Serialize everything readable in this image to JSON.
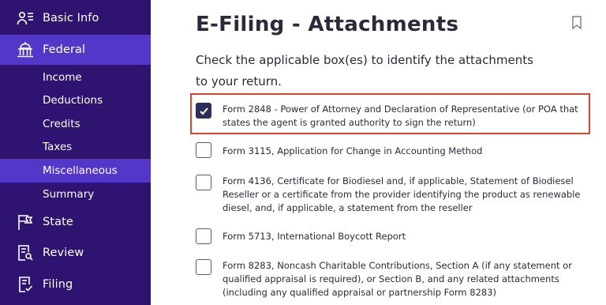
{
  "sidebar": {
    "items": [
      {
        "label": "Basic Info",
        "icon": "person-list-icon"
      },
      {
        "label": "Federal",
        "icon": "capitol-icon",
        "active": true
      },
      {
        "label": "State",
        "icon": "flag-icon"
      },
      {
        "label": "Review",
        "icon": "document-search-icon"
      },
      {
        "label": "Filing",
        "icon": "document-check-icon"
      }
    ],
    "sub_items": [
      "Income",
      "Deductions",
      "Credits",
      "Taxes",
      "Miscellaneous",
      "Summary"
    ],
    "selected_sub": "Miscellaneous"
  },
  "main": {
    "title": "E-Filing - Attachments",
    "instructions": "Check the applicable box(es) to identify the attachments to your return.",
    "options": [
      {
        "label": "Form 2848 - Power of Attorney and Declaration of Representative (or POA that states the agent is granted authority to sign the return)",
        "checked": true
      },
      {
        "label": "Form 3115, Application for Change in Accounting Method",
        "checked": false
      },
      {
        "label": "Form 4136, Certificate for Biodiesel and, if applicable, Statement of Biodiesel Reseller or a certificate from the provider identifying the product as renewable diesel, and, if applicable, a statement from the reseller",
        "checked": false
      },
      {
        "label": "Form 5713, International Boycott Report",
        "checked": false
      },
      {
        "label": "Form 8283, Noncash Charitable Contributions, Section A (if any statement or qualified appraisal is required), or Section B, and any related attachments (including any qualified appraisal or partnership Form 8283)",
        "checked": false
      }
    ]
  },
  "colors": {
    "sidebar_bg": "#2e1470",
    "sidebar_active": "#5237c8",
    "highlight": "#e0432c",
    "checkbox_checked": "#2e2e5a"
  }
}
